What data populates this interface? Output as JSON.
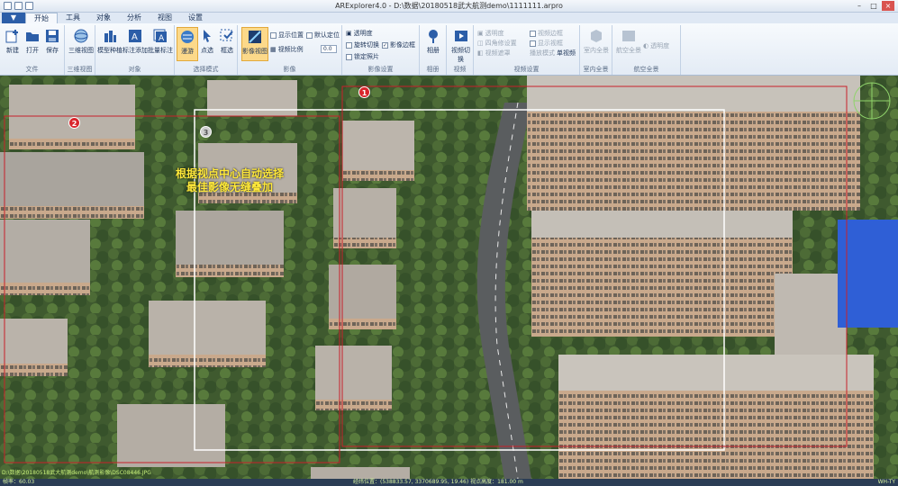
{
  "window": {
    "title": "ARExplorer4.0 - D:\\数据\\20180518武大航测demo\\1111111.arpro"
  },
  "tabs": [
    {
      "label": "开始"
    },
    {
      "label": "工具"
    },
    {
      "label": "对象"
    },
    {
      "label": "分析"
    },
    {
      "label": "视图"
    },
    {
      "label": "设置"
    }
  ],
  "ribbon": {
    "file": {
      "new": "新建",
      "open": "打开",
      "save": "保存",
      "group": "文件"
    },
    "model3d": {
      "view3d": "三维视图",
      "group": "三维视图"
    },
    "object": {
      "model_add": "模型种植",
      "label_add": "标注添加",
      "batch_label": "批量标注",
      "group": "对象"
    },
    "select_mode": {
      "browse": "漫游",
      "point": "点选",
      "box": "框选",
      "group": "选择模式"
    },
    "imagery": {
      "image_view": "影像视图",
      "show_pos": "显示位置",
      "default_pos": "默认定位",
      "image_ratio": "视频比例",
      "ratio_val": "0.0",
      "group": "影像"
    },
    "image_settings": {
      "transparency": "透明度",
      "rotate_switch": "旋转切换",
      "image_border": "影像边框",
      "lock_photo": "锁定照片",
      "group": "影像设置"
    },
    "album": {
      "label": "相册",
      "group": "相册"
    },
    "video": {
      "label": "视频切换",
      "group": "视频"
    },
    "video_settings": {
      "transparency": "透明度",
      "view_frame": "视频边框",
      "four_corner": "四角修设置",
      "show_frame": "显示视框",
      "video_mask": "视频遮罩",
      "display_mode": "播放模式",
      "mode_val": "单视频",
      "group": "视频设置"
    },
    "indoor": {
      "label": "室内全景",
      "group": "室内全景"
    },
    "air_pano": {
      "label": "航空全景",
      "transparency": "透明度",
      "group": "航空全景"
    }
  },
  "map": {
    "overlay_line1": "根据视点中心自动选择",
    "overlay_line2": "最佳影像无缝叠加",
    "badges": [
      "1",
      "2",
      "3"
    ],
    "file_path": "D:\\数据\\20180518武大航测demo\\航测影像\\DSC08446.JPG",
    "colors": {
      "badge_red": "#d9262c",
      "badge_grey": "#cfcfcf",
      "frame_red": "#c8202a",
      "frame_white": "#ffffff"
    }
  },
  "status": {
    "frame_rate": "帧率：60.03",
    "coords": "经纬位置：(538833.57, 3370689.95, 19.46)  视点高度：181.00 m",
    "orientation": "WH-TY"
  }
}
